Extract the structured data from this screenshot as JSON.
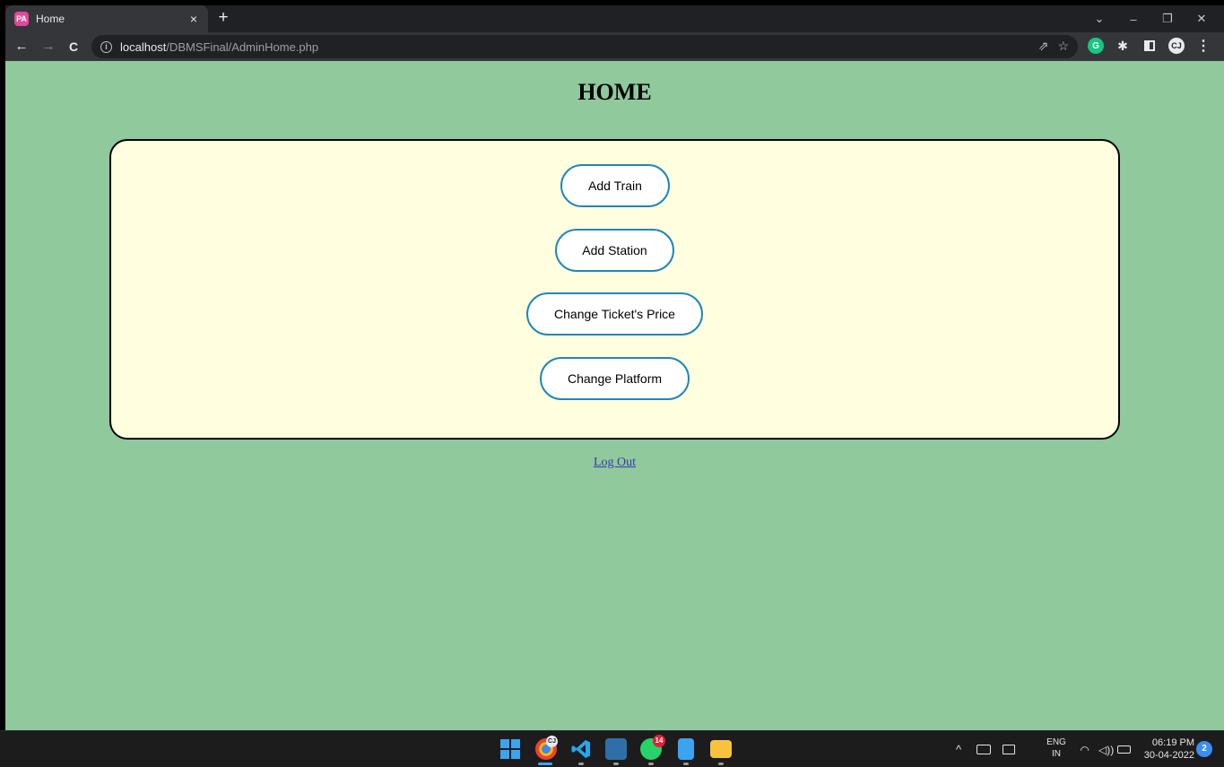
{
  "browser": {
    "tab_title": "Home",
    "tab_favicon": "PA",
    "tab_close": "×",
    "new_tab": "+",
    "url_host": "localhost",
    "url_path": "/DBMSFinal/AdminHome.php",
    "window_controls": {
      "tabs_dropdown": "⌄",
      "minimize": "–",
      "restore": "❐",
      "close": "✕"
    },
    "nav": {
      "back": "←",
      "forward": "→",
      "reload": "C"
    },
    "omnibox_info": "i",
    "share_icon": "⇗",
    "star_icon": "☆",
    "ext_grammarly": "G",
    "ext_puzzle": "✱",
    "ext_profile": "CJ",
    "menu": "⋮"
  },
  "page": {
    "title": "HOME",
    "buttons": [
      {
        "label": "Add Train"
      },
      {
        "label": "Add Station"
      },
      {
        "label": "Change Ticket's Price"
      },
      {
        "label": "Change Platform"
      }
    ],
    "logout_link": "Log Out"
  },
  "taskbar": {
    "whatsapp_badge": "14",
    "chrome_badge": "CJ",
    "tray_chevron": "^",
    "language_line1": "ENG",
    "language_line2": "IN",
    "time": "06:19 PM",
    "date": "30-04-2022",
    "notifications": "2"
  },
  "colors": {
    "page_background": "#8fc99c",
    "panel_background": "#ffffe0",
    "button_border": "#1f87b8",
    "link": "#3a37b8"
  }
}
